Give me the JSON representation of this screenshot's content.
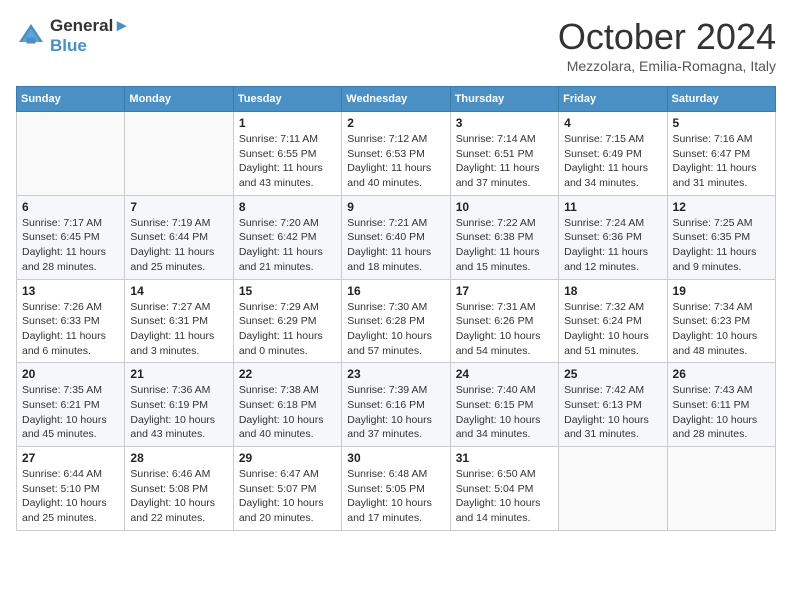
{
  "header": {
    "logo_line1": "General",
    "logo_line2": "Blue",
    "month_title": "October 2024",
    "location": "Mezzolara, Emilia-Romagna, Italy"
  },
  "days_of_week": [
    "Sunday",
    "Monday",
    "Tuesday",
    "Wednesday",
    "Thursday",
    "Friday",
    "Saturday"
  ],
  "weeks": [
    [
      {
        "day": "",
        "info": ""
      },
      {
        "day": "",
        "info": ""
      },
      {
        "day": "1",
        "info": "Sunrise: 7:11 AM\nSunset: 6:55 PM\nDaylight: 11 hours and 43 minutes."
      },
      {
        "day": "2",
        "info": "Sunrise: 7:12 AM\nSunset: 6:53 PM\nDaylight: 11 hours and 40 minutes."
      },
      {
        "day": "3",
        "info": "Sunrise: 7:14 AM\nSunset: 6:51 PM\nDaylight: 11 hours and 37 minutes."
      },
      {
        "day": "4",
        "info": "Sunrise: 7:15 AM\nSunset: 6:49 PM\nDaylight: 11 hours and 34 minutes."
      },
      {
        "day": "5",
        "info": "Sunrise: 7:16 AM\nSunset: 6:47 PM\nDaylight: 11 hours and 31 minutes."
      }
    ],
    [
      {
        "day": "6",
        "info": "Sunrise: 7:17 AM\nSunset: 6:45 PM\nDaylight: 11 hours and 28 minutes."
      },
      {
        "day": "7",
        "info": "Sunrise: 7:19 AM\nSunset: 6:44 PM\nDaylight: 11 hours and 25 minutes."
      },
      {
        "day": "8",
        "info": "Sunrise: 7:20 AM\nSunset: 6:42 PM\nDaylight: 11 hours and 21 minutes."
      },
      {
        "day": "9",
        "info": "Sunrise: 7:21 AM\nSunset: 6:40 PM\nDaylight: 11 hours and 18 minutes."
      },
      {
        "day": "10",
        "info": "Sunrise: 7:22 AM\nSunset: 6:38 PM\nDaylight: 11 hours and 15 minutes."
      },
      {
        "day": "11",
        "info": "Sunrise: 7:24 AM\nSunset: 6:36 PM\nDaylight: 11 hours and 12 minutes."
      },
      {
        "day": "12",
        "info": "Sunrise: 7:25 AM\nSunset: 6:35 PM\nDaylight: 11 hours and 9 minutes."
      }
    ],
    [
      {
        "day": "13",
        "info": "Sunrise: 7:26 AM\nSunset: 6:33 PM\nDaylight: 11 hours and 6 minutes."
      },
      {
        "day": "14",
        "info": "Sunrise: 7:27 AM\nSunset: 6:31 PM\nDaylight: 11 hours and 3 minutes."
      },
      {
        "day": "15",
        "info": "Sunrise: 7:29 AM\nSunset: 6:29 PM\nDaylight: 11 hours and 0 minutes."
      },
      {
        "day": "16",
        "info": "Sunrise: 7:30 AM\nSunset: 6:28 PM\nDaylight: 10 hours and 57 minutes."
      },
      {
        "day": "17",
        "info": "Sunrise: 7:31 AM\nSunset: 6:26 PM\nDaylight: 10 hours and 54 minutes."
      },
      {
        "day": "18",
        "info": "Sunrise: 7:32 AM\nSunset: 6:24 PM\nDaylight: 10 hours and 51 minutes."
      },
      {
        "day": "19",
        "info": "Sunrise: 7:34 AM\nSunset: 6:23 PM\nDaylight: 10 hours and 48 minutes."
      }
    ],
    [
      {
        "day": "20",
        "info": "Sunrise: 7:35 AM\nSunset: 6:21 PM\nDaylight: 10 hours and 45 minutes."
      },
      {
        "day": "21",
        "info": "Sunrise: 7:36 AM\nSunset: 6:19 PM\nDaylight: 10 hours and 43 minutes."
      },
      {
        "day": "22",
        "info": "Sunrise: 7:38 AM\nSunset: 6:18 PM\nDaylight: 10 hours and 40 minutes."
      },
      {
        "day": "23",
        "info": "Sunrise: 7:39 AM\nSunset: 6:16 PM\nDaylight: 10 hours and 37 minutes."
      },
      {
        "day": "24",
        "info": "Sunrise: 7:40 AM\nSunset: 6:15 PM\nDaylight: 10 hours and 34 minutes."
      },
      {
        "day": "25",
        "info": "Sunrise: 7:42 AM\nSunset: 6:13 PM\nDaylight: 10 hours and 31 minutes."
      },
      {
        "day": "26",
        "info": "Sunrise: 7:43 AM\nSunset: 6:11 PM\nDaylight: 10 hours and 28 minutes."
      }
    ],
    [
      {
        "day": "27",
        "info": "Sunrise: 6:44 AM\nSunset: 5:10 PM\nDaylight: 10 hours and 25 minutes."
      },
      {
        "day": "28",
        "info": "Sunrise: 6:46 AM\nSunset: 5:08 PM\nDaylight: 10 hours and 22 minutes."
      },
      {
        "day": "29",
        "info": "Sunrise: 6:47 AM\nSunset: 5:07 PM\nDaylight: 10 hours and 20 minutes."
      },
      {
        "day": "30",
        "info": "Sunrise: 6:48 AM\nSunset: 5:05 PM\nDaylight: 10 hours and 17 minutes."
      },
      {
        "day": "31",
        "info": "Sunrise: 6:50 AM\nSunset: 5:04 PM\nDaylight: 10 hours and 14 minutes."
      },
      {
        "day": "",
        "info": ""
      },
      {
        "day": "",
        "info": ""
      }
    ]
  ]
}
